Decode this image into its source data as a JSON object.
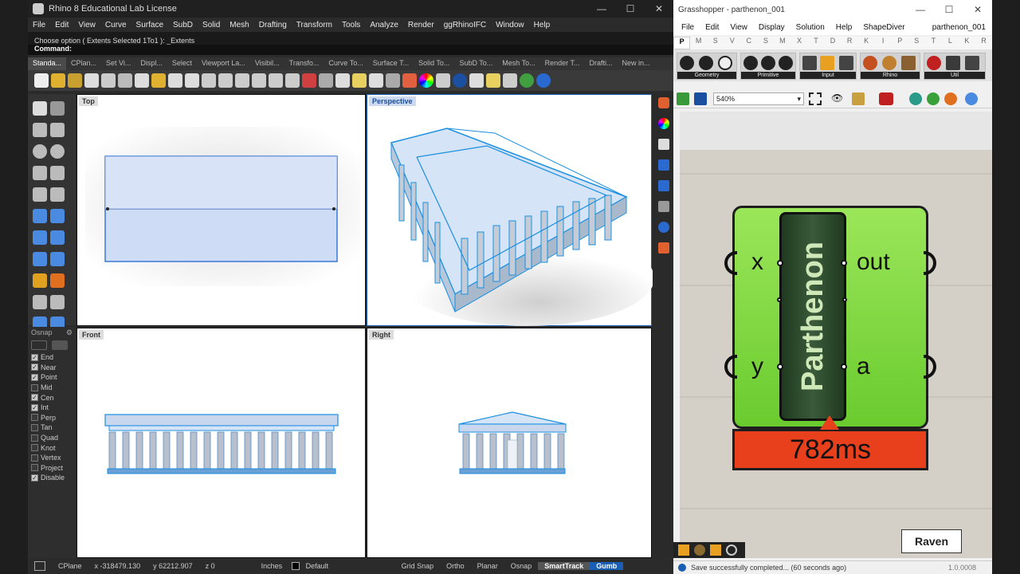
{
  "rhino": {
    "title": "Rhino 8 Educational Lab License",
    "menu": [
      "File",
      "Edit",
      "View",
      "Curve",
      "Surface",
      "SubD",
      "Solid",
      "Mesh",
      "Drafting",
      "Transform",
      "Tools",
      "Analyze",
      "Render",
      "ggRhinoIFC",
      "Window",
      "Help"
    ],
    "cmd_history": "Choose option ( Extents  Selected  1To1 ): _Extents",
    "command_label": "Command:",
    "tabs": [
      "Standa...",
      "CPlan...",
      "Set Vi...",
      "Displ...",
      "Select",
      "Viewport La...",
      "Visibil...",
      "Transfo...",
      "Curve To...",
      "Surface T...",
      "Solid To...",
      "SubD To...",
      "Mesh To...",
      "Render T...",
      "Drafti...",
      "New in..."
    ],
    "viewports": {
      "top": "Top",
      "perspective": "Perspective",
      "front": "Front",
      "right": "Right"
    },
    "osnap": {
      "title": "Osnap",
      "items": [
        {
          "label": "End",
          "checked": true
        },
        {
          "label": "Near",
          "checked": true
        },
        {
          "label": "Point",
          "checked": true
        },
        {
          "label": "Mid",
          "checked": false
        },
        {
          "label": "Cen",
          "checked": true
        },
        {
          "label": "Int",
          "checked": true
        },
        {
          "label": "Perp",
          "checked": false
        },
        {
          "label": "Tan",
          "checked": false
        },
        {
          "label": "Quad",
          "checked": false
        },
        {
          "label": "Knot",
          "checked": false
        },
        {
          "label": "Vertex",
          "checked": false
        },
        {
          "label": "Project",
          "checked": false
        },
        {
          "label": "Disable",
          "checked": true
        }
      ]
    },
    "status": {
      "cplane": "CPlane",
      "x": "x -318479.130",
      "y": "y 62212.907",
      "z": "z 0",
      "units": "Inches",
      "layer": "Default",
      "grid_snap": "Grid Snap",
      "ortho": "Ortho",
      "planar": "Planar",
      "osnap": "Osnap",
      "smarttrack": "SmartTrack",
      "gumball": "Gumb"
    }
  },
  "grasshopper": {
    "title": "Grasshopper - parthenon_001",
    "doc_name": "parthenon_001",
    "menu": [
      "File",
      "Edit",
      "View",
      "Display",
      "Solution",
      "Help",
      "ShapeDiver"
    ],
    "categories": [
      "P",
      "M",
      "S",
      "V",
      "C",
      "S",
      "M",
      "X",
      "T",
      "D",
      "R",
      "K",
      "I",
      "P",
      "S",
      "T",
      "L",
      "K",
      "R"
    ],
    "ribbon_groups": [
      "Geometry",
      "Primitive",
      "Input",
      "Rhino",
      "Util"
    ],
    "zoom": "540%",
    "component": {
      "name": "Parthenon",
      "inputs": [
        "x",
        "y"
      ],
      "outputs": [
        "out",
        "a"
      ],
      "timing": "782ms"
    },
    "raven_label": "Raven",
    "status": "Save successfully completed... (60 seconds ago)",
    "version": "1.0.0008"
  },
  "colors": {
    "component_green": "#7fd93e",
    "component_dark": "#2e4a2e",
    "timing_red": "#e8401c",
    "rhino_selection_blue": "#1a8fe0"
  }
}
